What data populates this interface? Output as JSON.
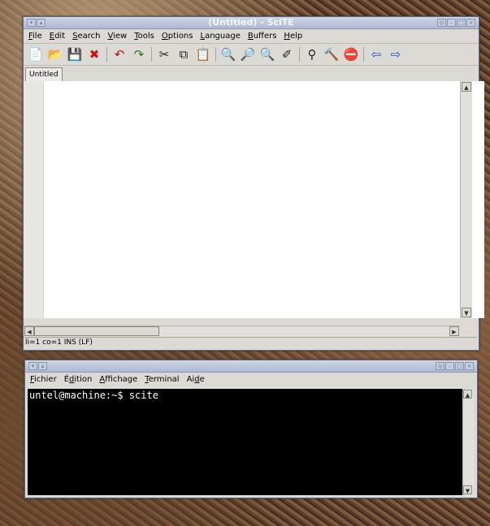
{
  "scite": {
    "title": "(Untitled) - SciTE",
    "menu": [
      {
        "pre": "",
        "u": "F",
        "post": "ile"
      },
      {
        "pre": "",
        "u": "E",
        "post": "dit"
      },
      {
        "pre": "",
        "u": "S",
        "post": "earch"
      },
      {
        "pre": "",
        "u": "V",
        "post": "iew"
      },
      {
        "pre": "",
        "u": "T",
        "post": "ools"
      },
      {
        "pre": "",
        "u": "O",
        "post": "ptions"
      },
      {
        "pre": "",
        "u": "L",
        "post": "anguage"
      },
      {
        "pre": "",
        "u": "B",
        "post": "uffers"
      },
      {
        "pre": "",
        "u": "H",
        "post": "elp"
      }
    ],
    "toolbar_groups": [
      [
        {
          "name": "new-file-icon",
          "glyph": "📄",
          "color": "#c9a400"
        },
        {
          "name": "open-folder-icon",
          "glyph": "📂",
          "color": "#c9a400"
        },
        {
          "name": "save-icon",
          "glyph": "💾",
          "color": "#555"
        },
        {
          "name": "close-icon",
          "glyph": "✖",
          "color": "#d01010"
        }
      ],
      [
        {
          "name": "undo-icon",
          "glyph": "↶",
          "color": "#c01010"
        },
        {
          "name": "redo-icon",
          "glyph": "↷",
          "color": "#208020"
        }
      ],
      [
        {
          "name": "cut-icon",
          "glyph": "✂",
          "color": "#222"
        },
        {
          "name": "copy-icon",
          "glyph": "⧉",
          "color": "#222"
        },
        {
          "name": "paste-icon",
          "glyph": "📋",
          "color": "#222"
        }
      ],
      [
        {
          "name": "find-icon",
          "glyph": "🔍",
          "color": "#222"
        },
        {
          "name": "find-next-icon",
          "glyph": "🔎",
          "color": "#222"
        },
        {
          "name": "find-in-files-icon",
          "glyph": "🔍",
          "color": "#222"
        },
        {
          "name": "replace-icon",
          "glyph": "✐",
          "color": "#222"
        }
      ],
      [
        {
          "name": "binoculars-icon",
          "glyph": "⚲",
          "color": "#222"
        },
        {
          "name": "compile-icon",
          "glyph": "🔨",
          "color": "#444"
        },
        {
          "name": "stop-icon",
          "glyph": "⛔",
          "color": "#c02020"
        }
      ],
      [
        {
          "name": "previous-buffer-icon",
          "glyph": "⇦",
          "color": "#2050c0"
        },
        {
          "name": "next-buffer-icon",
          "glyph": "⇨",
          "color": "#2050c0"
        }
      ]
    ],
    "tab_label": "Untitled",
    "status": "li=1 co=1 INS (LF)"
  },
  "terminal": {
    "menu": [
      {
        "pre": "",
        "u": "F",
        "post": "ichier"
      },
      {
        "pre": "É",
        "u": "d",
        "post": "ition"
      },
      {
        "pre": "",
        "u": "A",
        "post": "ffichage"
      },
      {
        "pre": "",
        "u": "T",
        "post": "erminal"
      },
      {
        "pre": "Ai",
        "u": "d",
        "post": "e"
      }
    ],
    "prompt": "untel@machine:~$ scite"
  }
}
